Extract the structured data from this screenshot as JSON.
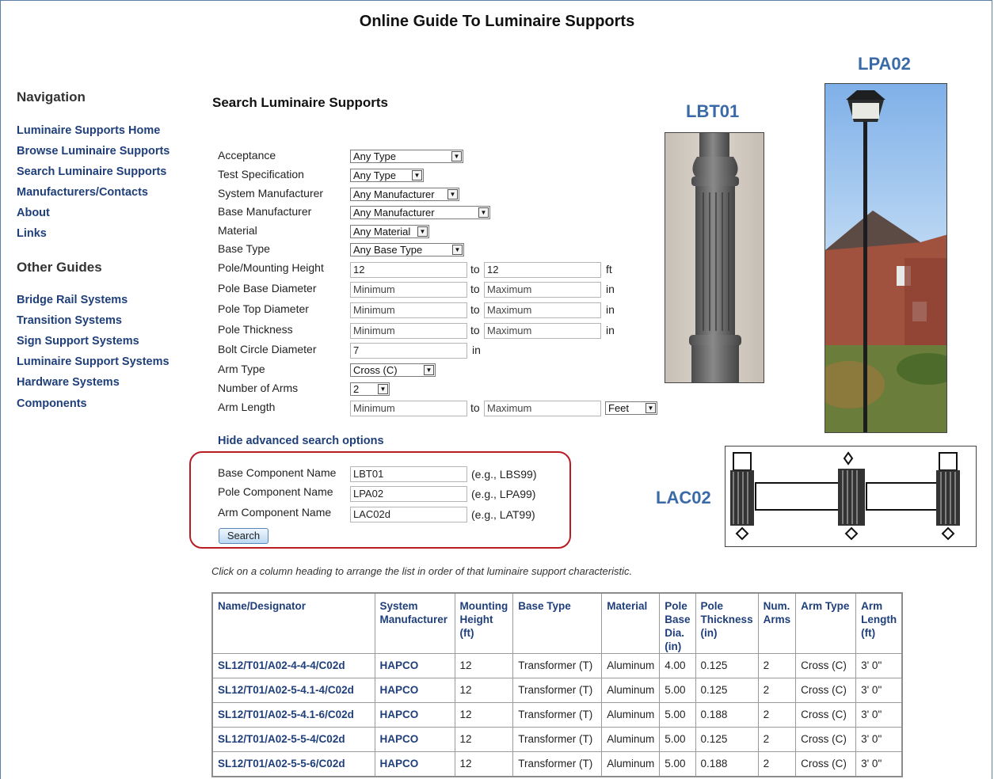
{
  "page_title": "Online Guide To Luminaire Supports",
  "nav": {
    "heading": "Navigation",
    "links": [
      "Luminaire Supports Home",
      "Browse Luminaire Supports",
      "Search Luminaire Supports",
      "Manufacturers/Contacts",
      "About",
      "Links"
    ],
    "other_heading": "Other Guides",
    "other_links": [
      "Bridge Rail Systems",
      "Transition Systems",
      "Sign Support Systems",
      "Luminaire Support Systems",
      "Hardware Systems",
      "Components"
    ]
  },
  "search": {
    "heading": "Search Luminaire Supports",
    "fields": {
      "acceptance": {
        "label": "Acceptance",
        "value": "Any Type"
      },
      "test_spec": {
        "label": "Test Specification",
        "value": "Any Type"
      },
      "system_mfr": {
        "label": "System Manufacturer",
        "value": "Any Manufacturer"
      },
      "base_mfr": {
        "label": "Base Manufacturer",
        "value": "Any Manufacturer"
      },
      "material": {
        "label": "Material",
        "value": "Any Material"
      },
      "base_type": {
        "label": "Base Type",
        "value": "Any Base Type"
      },
      "pole_height": {
        "label": "Pole/Mounting Height",
        "min": "12",
        "max": "12",
        "unit": "ft"
      },
      "pole_base_dia": {
        "label": "Pole Base Diameter",
        "min": "Minimum",
        "max": "Maximum",
        "unit": "in"
      },
      "pole_top_dia": {
        "label": "Pole Top Diameter",
        "min": "Minimum",
        "max": "Maximum",
        "unit": "in"
      },
      "pole_thickness": {
        "label": "Pole Thickness",
        "min": "Minimum",
        "max": "Maximum",
        "unit": "in"
      },
      "bolt_circle": {
        "label": "Bolt Circle Diameter",
        "value": "7",
        "unit": "in"
      },
      "arm_type": {
        "label": "Arm Type",
        "value": "Cross (C)"
      },
      "num_arms": {
        "label": "Number of Arms",
        "value": "2"
      },
      "arm_length": {
        "label": "Arm Length",
        "min": "Minimum",
        "max": "Maximum",
        "unit": "Feet"
      }
    },
    "to": "to",
    "hide_link": "Hide advanced search options",
    "components": {
      "base": {
        "label": "Base Component Name",
        "value": "LBT01",
        "example": "(e.g., LBS99)"
      },
      "pole": {
        "label": "Pole Component Name",
        "value": "LPA02",
        "example": "(e.g., LPA99)"
      },
      "arm": {
        "label": "Arm Component Name",
        "value": "LAC02d",
        "example": "(e.g., LAT99)"
      }
    },
    "button": "Search"
  },
  "images": {
    "base": "LBT01",
    "pole": "LPA02",
    "arm": "LAC02"
  },
  "hint": "Click on a column heading to arrange the list in order of that luminaire support characteristic.",
  "table": {
    "headers": [
      "Name/Designator",
      "System Manufacturer",
      "Mounting Height (ft)",
      "Base Type",
      "Material",
      "Pole Base Dia. (in)",
      "Pole Thickness (in)",
      "Num. Arms",
      "Arm Type",
      "Arm Length (ft)"
    ],
    "rows": [
      [
        "SL12/T01/A02-4-4-4/C02d",
        "HAPCO",
        "12",
        "Transformer (T)",
        "Aluminum",
        "4.00",
        "0.125",
        "2",
        "Cross (C)",
        "3' 0\""
      ],
      [
        "SL12/T01/A02-5-4.1-4/C02d",
        "HAPCO",
        "12",
        "Transformer (T)",
        "Aluminum",
        "5.00",
        "0.125",
        "2",
        "Cross (C)",
        "3' 0\""
      ],
      [
        "SL12/T01/A02-5-4.1-6/C02d",
        "HAPCO",
        "12",
        "Transformer (T)",
        "Aluminum",
        "5.00",
        "0.188",
        "2",
        "Cross (C)",
        "3' 0\""
      ],
      [
        "SL12/T01/A02-5-5-4/C02d",
        "HAPCO",
        "12",
        "Transformer (T)",
        "Aluminum",
        "5.00",
        "0.125",
        "2",
        "Cross (C)",
        "3' 0\""
      ],
      [
        "SL12/T01/A02-5-5-6/C02d",
        "HAPCO",
        "12",
        "Transformer (T)",
        "Aluminum",
        "5.00",
        "0.188",
        "2",
        "Cross (C)",
        "3' 0\""
      ]
    ]
  }
}
